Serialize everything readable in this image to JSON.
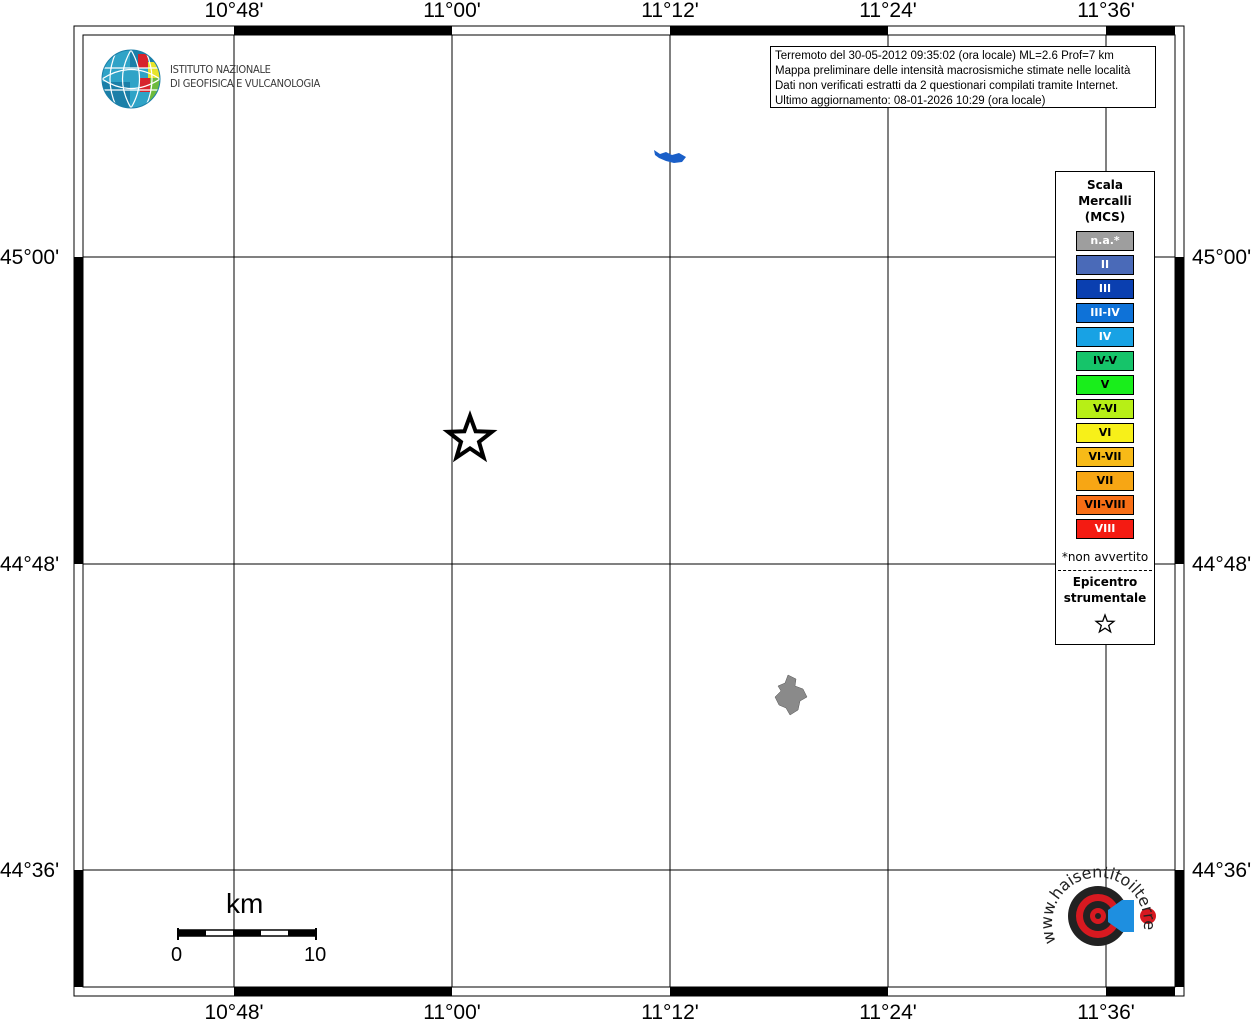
{
  "map": {
    "grid_x_labels": [
      "10°48'",
      "11°00'",
      "11°12'",
      "11°24'",
      "11°36'"
    ],
    "grid_y_labels": [
      "45°00'",
      "44°48'",
      "44°36'"
    ]
  },
  "logo": {
    "line1": "ISTITUTO NAZIONALE",
    "line2": "DI GEOFISICA E VULCANOLOGIA"
  },
  "info": {
    "line1": "Terremoto del 30-05-2012 09:35:02 (ora locale) ML=2.6 Prof=7 km",
    "line2": "Mappa preliminare delle intensità macrosismiche stimate nelle località",
    "line3": "Dati non verificati estratti da 2 questionari compilati tramite Internet.",
    "line4": "Ultimo aggiornamento: 08-01-2026 10:29 (ora locale)"
  },
  "legend": {
    "title_line1": "Scala",
    "title_line2": "Mercalli",
    "title_line3": "(MCS)",
    "items": [
      {
        "label": "n.a.*",
        "color": "#9e9e9e",
        "text_color": "#ffffff"
      },
      {
        "label": "II",
        "color": "#4a6ab8",
        "text_color": "#ffffff"
      },
      {
        "label": "III",
        "color": "#0a3fb0",
        "text_color": "#ffffff"
      },
      {
        "label": "III-IV",
        "color": "#0e72d8",
        "text_color": "#ffffff"
      },
      {
        "label": "IV",
        "color": "#18a2e4",
        "text_color": "#ffffff"
      },
      {
        "label": "IV-V",
        "color": "#16c46a",
        "text_color": "#000000"
      },
      {
        "label": "V",
        "color": "#19ee1b",
        "text_color": "#000000"
      },
      {
        "label": "V-VI",
        "color": "#b7ef16",
        "text_color": "#000000"
      },
      {
        "label": "VI",
        "color": "#f7f019",
        "text_color": "#000000"
      },
      {
        "label": "VI-VII",
        "color": "#f7ba17",
        "text_color": "#000000"
      },
      {
        "label": "VII",
        "color": "#f7a614",
        "text_color": "#000000"
      },
      {
        "label": "VII-VIII",
        "color": "#f86e15",
        "text_color": "#000000"
      },
      {
        "label": "VIII",
        "color": "#f41b12",
        "text_color": "#ffffff"
      }
    ],
    "note": "*non avvertito",
    "epicenter_line1": "Epicentro",
    "epicenter_line2": "strumentale"
  },
  "scale_bar": {
    "unit": "km",
    "min": "0",
    "max": "10"
  },
  "badge": {
    "text": "www.haisentitoilterremoto.it"
  },
  "colors": {
    "lake": "#1a5fc8",
    "urban": "#8a8a8a",
    "badge_red": "#d71920",
    "badge_blue": "#1e8fe0"
  }
}
